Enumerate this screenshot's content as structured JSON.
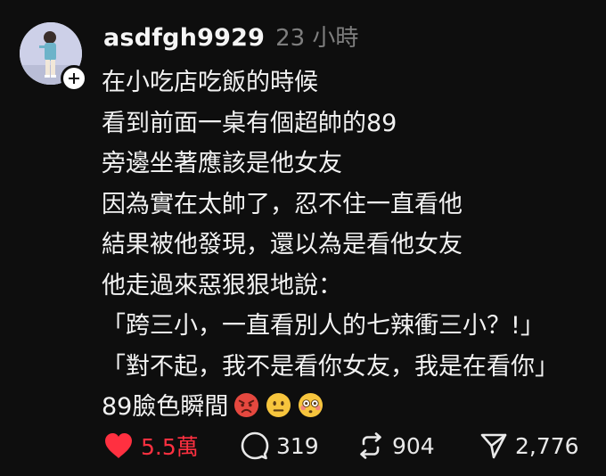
{
  "post": {
    "username": "asdfgh9929",
    "timestamp": "23 小時",
    "lines": [
      "在小吃店吃飯的時候",
      "看到前面一桌有個超帥的89",
      "旁邊坐著應該是他女友",
      "因為實在太帥了，忍不住一直看他",
      "結果被他發現，還以為是看他女友",
      "他走過來惡狠狠地說：",
      "「跨三小，一直看別人的七辣衝三小？!」",
      "「對不起，我不是看你女友，我是在看你」",
      "89臉色瞬間"
    ],
    "emojis": [
      "angry-face-emoji",
      "neutral-face-emoji",
      "flushed-face-emoji"
    ]
  },
  "actions": {
    "like_count": "5.5萬",
    "comment_count": "319",
    "repost_count": "904",
    "share_count": "2,776"
  },
  "colors": {
    "background": "#0e0e0e",
    "text": "#f2f2f2",
    "muted": "#7e7e7e",
    "like": "#ff3040"
  },
  "icons": {
    "like": "heart-filled-icon",
    "comment": "comment-bubble-icon",
    "repost": "repost-arrows-icon",
    "share": "send-paper-plane-icon",
    "follow": "plus-icon"
  }
}
